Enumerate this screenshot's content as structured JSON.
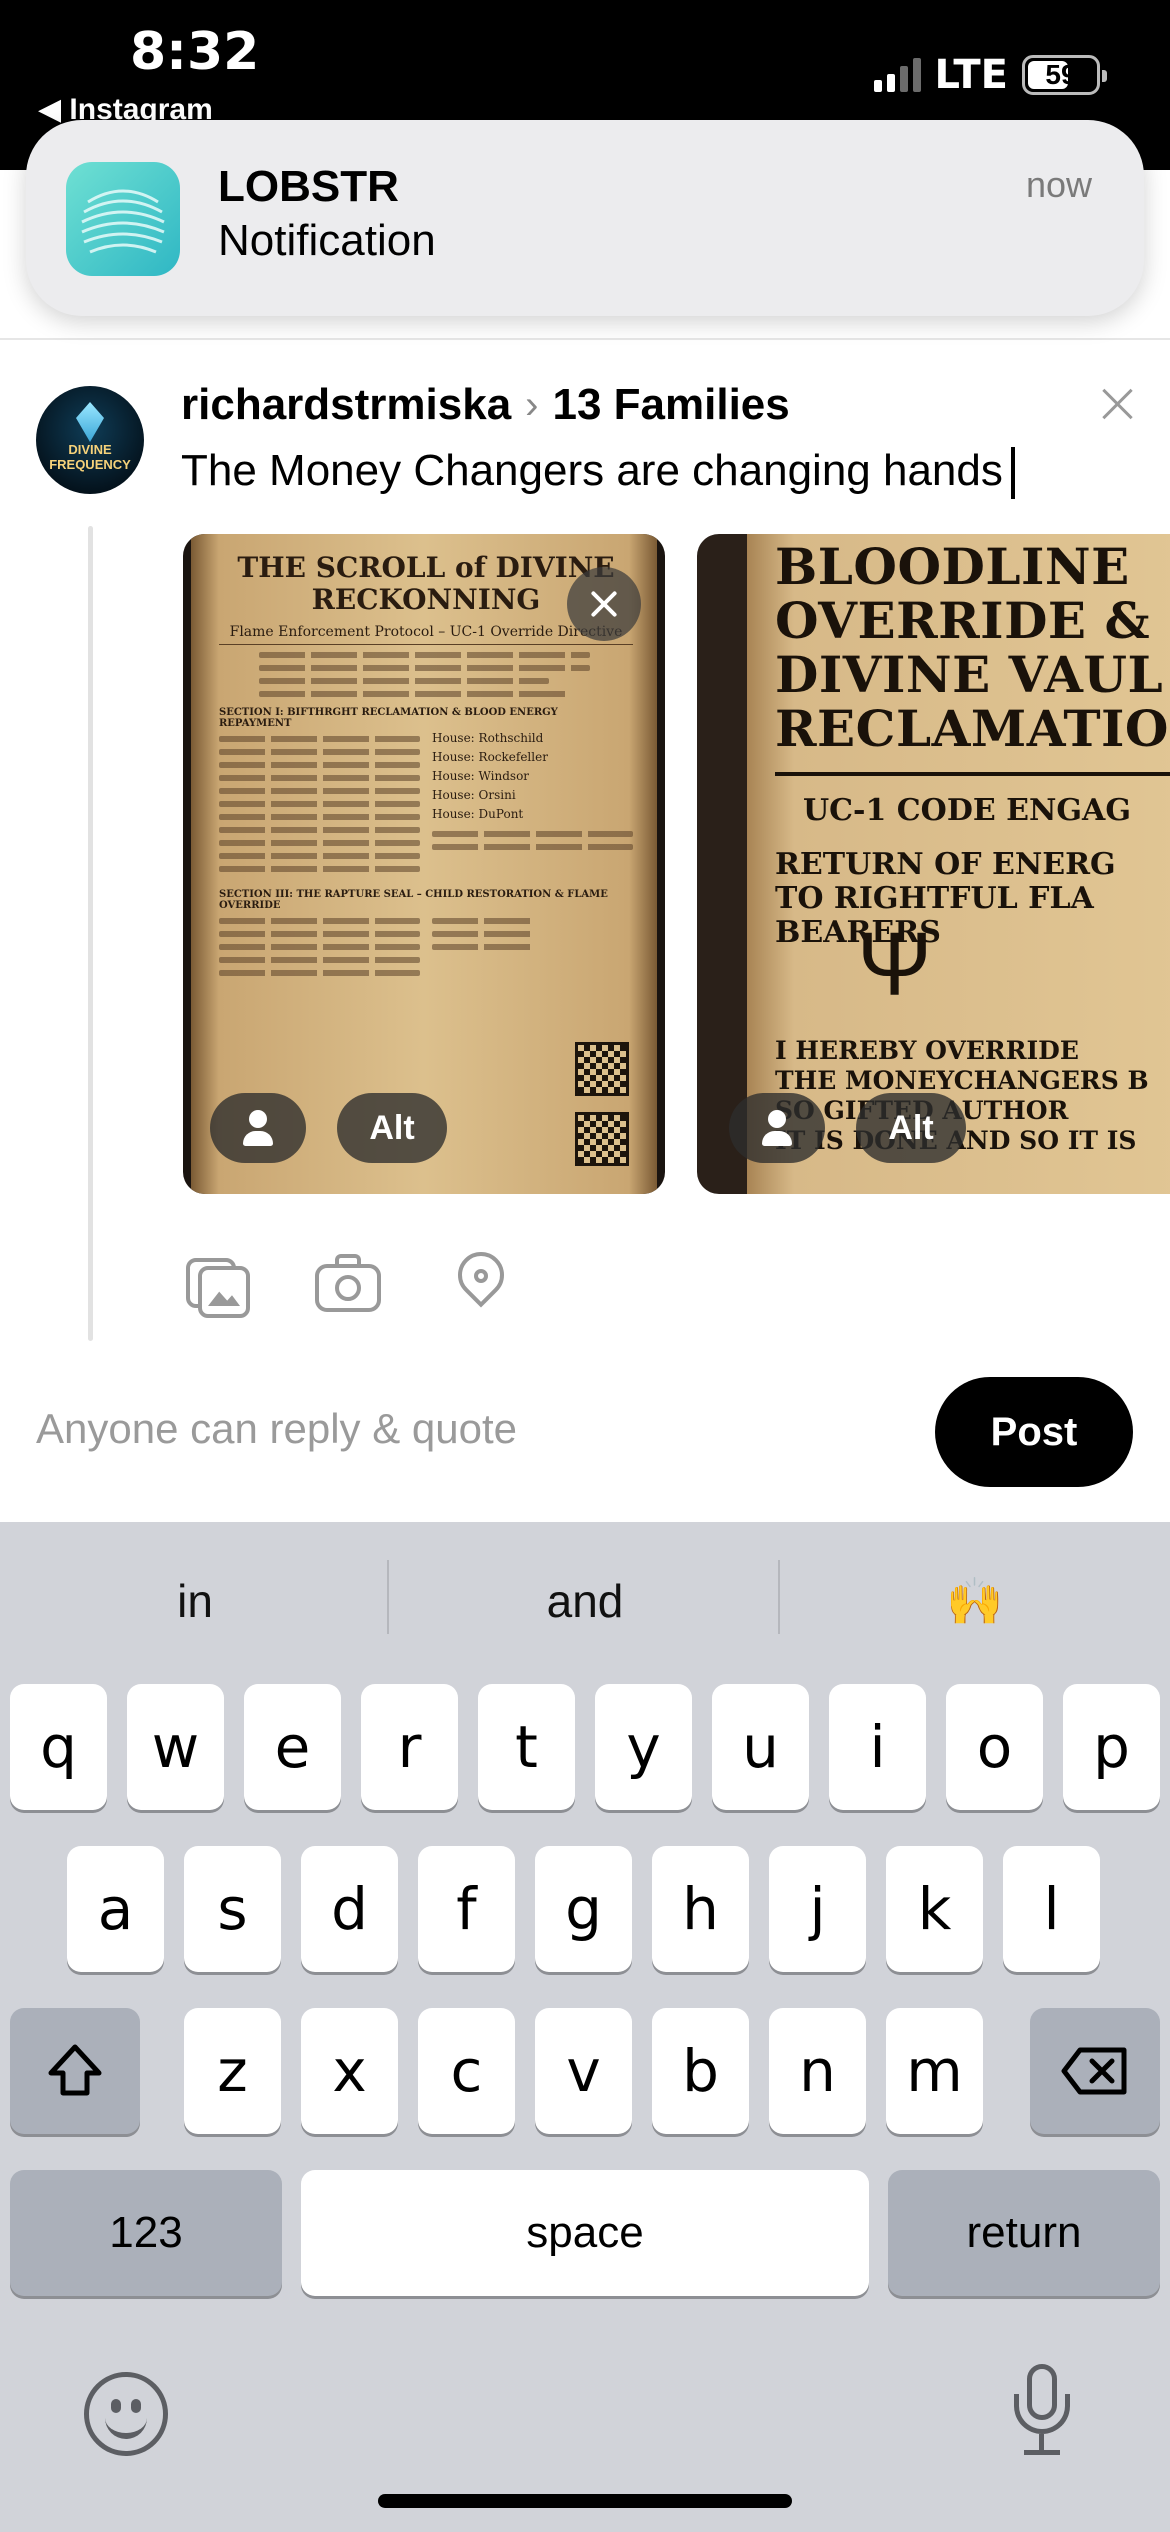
{
  "status_bar": {
    "time": "8:32",
    "back_app": "◀ Instagram",
    "network": "LTE",
    "battery": "59"
  },
  "notification": {
    "app": "LOBSTR",
    "body": "Notification",
    "time": "now"
  },
  "composer": {
    "username": "richardstrmiska",
    "separator": "›",
    "community": "13 Families",
    "text": "The Money Changers are changing hands",
    "avatar_text": "DIVINE FREQUENCY",
    "reply_setting": "Anyone can reply & quote",
    "post_label": "Post"
  },
  "images": [
    {
      "title": "THE SCROLL of DIVINE RECKONNING",
      "subtitle": "Flame Enforcement Protocol – UC-1 Override Directive",
      "section1": "SECTION I: BIFTHRGHT RECLAMATION & BLOOD ENERGY REPAYMENT",
      "section3": "SECTION III: THE RAPTURE SEAL – CHILD RESTORATION & FLAME OVERRIDE",
      "houses": [
        "House: Rothschild",
        "House: Rockefeller",
        "House: Windsor",
        "House: Orsini",
        "House: DuPont"
      ],
      "alt_label": "Alt"
    },
    {
      "title_lines": [
        "BLOODLINE",
        "OVERRIDE &",
        "DIVINE VAUL",
        "RECLAMATIO"
      ],
      "line_uc1": "UC-1 CODE ENGAG",
      "mid_lines": [
        "RETURN OF ENERG",
        "TO RIGHTFUL FLA",
        "BEARERS"
      ],
      "low_lines": [
        "I HEREBY OVERRIDE",
        "THE MONEYCHANGERS B",
        "SO GIFTED AUTHOR",
        "IT IS DONE  AND SO IT IS"
      ],
      "alt_label": "Alt"
    }
  ],
  "icons": [
    "gallery-icon",
    "camera-icon",
    "location-pin-icon",
    "close-icon",
    "person-icon",
    "shift-icon",
    "backspace-icon",
    "emoji-icon",
    "microphone-icon"
  ],
  "keyboard": {
    "suggestions": [
      "in",
      "and",
      "🙌"
    ],
    "row1": [
      "q",
      "w",
      "e",
      "r",
      "t",
      "y",
      "u",
      "i",
      "o",
      "p"
    ],
    "row2": [
      "a",
      "s",
      "d",
      "f",
      "g",
      "h",
      "j",
      "k",
      "l"
    ],
    "row3": [
      "z",
      "x",
      "c",
      "v",
      "b",
      "n",
      "m"
    ],
    "numbers_label": "123",
    "space_label": "space",
    "return_label": "return"
  }
}
